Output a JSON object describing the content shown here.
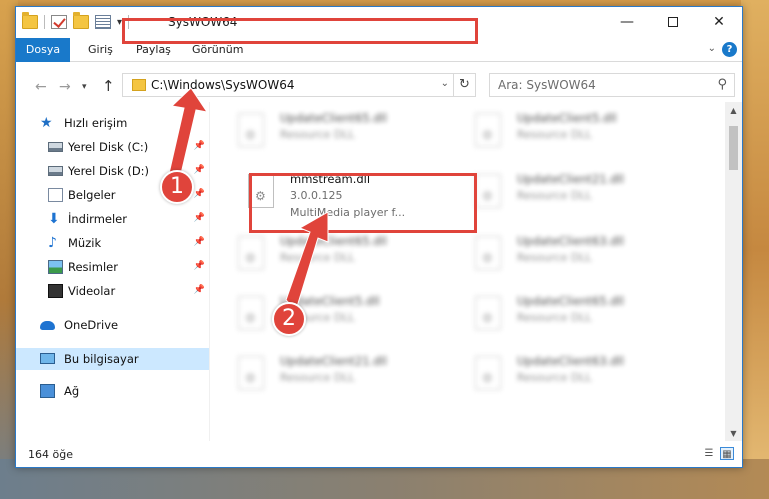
{
  "window": {
    "title": "SysWOW64",
    "min_glyph": "—",
    "close_glyph": "✕"
  },
  "ribbon": {
    "tabs": [
      "Dosya",
      "Giriş",
      "Paylaş",
      "Görünüm"
    ],
    "help_glyph": "?"
  },
  "address": {
    "path": "C:\\Windows\\SysWOW64",
    "refresh_glyph": "↻",
    "search_placeholder": "Ara: SysWOW64"
  },
  "nav_pane": {
    "items": [
      {
        "label": "Hızlı erişim",
        "icon": "star-icon",
        "pinned": false
      },
      {
        "label": "Yerel Disk (C:)",
        "icon": "drive-icon",
        "pinned": true
      },
      {
        "label": "Yerel Disk (D:)",
        "icon": "drive-icon",
        "pinned": true
      },
      {
        "label": "Belgeler",
        "icon": "documents-icon",
        "pinned": true
      },
      {
        "label": "İndirmeler",
        "icon": "download-icon",
        "pinned": true
      },
      {
        "label": "Müzik",
        "icon": "music-icon",
        "pinned": true
      },
      {
        "label": "Resimler",
        "icon": "pictures-icon",
        "pinned": true
      },
      {
        "label": "Videolar",
        "icon": "video-icon",
        "pinned": true
      },
      {
        "label": "OneDrive",
        "icon": "onedrive-icon",
        "pinned": false
      },
      {
        "label": "Bu bilgisayar",
        "icon": "computer-icon",
        "pinned": false,
        "selected": true
      },
      {
        "label": "Ağ",
        "icon": "network-icon",
        "pinned": false
      }
    ]
  },
  "files": {
    "left_column": [
      {
        "name": "UpdateClient65.dll",
        "type": "Resource DLL",
        "blurred": true
      },
      {
        "name": "mmstream.dll",
        "version": "3.0.0.125",
        "description": "MultiMedia player f...",
        "blurred": false
      },
      {
        "name": "UpdateClient65.dll",
        "type": "Resource DLL",
        "blurred": true
      },
      {
        "name": "UpdateClient5.dll",
        "type": "Resource DLL",
        "blurred": true
      },
      {
        "name": "UpdateClient21.dll",
        "type": "Resource DLL",
        "blurred": true
      }
    ],
    "right_column": [
      {
        "name": "UpdateClient5.dll",
        "type": "Resource DLL",
        "blurred": true
      },
      {
        "name": "UpdateClient21.dll",
        "type": "Resource DLL",
        "blurred": true
      },
      {
        "name": "UpdateClient63.dll",
        "type": "Resource DLL",
        "blurred": true
      },
      {
        "name": "UpdateClient65.dll",
        "type": "Resource DLL",
        "blurred": true
      },
      {
        "name": "UpdateClient63.dll",
        "type": "Resource DLL",
        "blurred": true
      }
    ]
  },
  "status": {
    "item_count": "164 öğe"
  },
  "annotations": {
    "step1": "1",
    "step2": "2",
    "color": "#e0443b"
  },
  "colors": {
    "accent": "#1979ca",
    "selected_bg": "#cce8ff"
  }
}
